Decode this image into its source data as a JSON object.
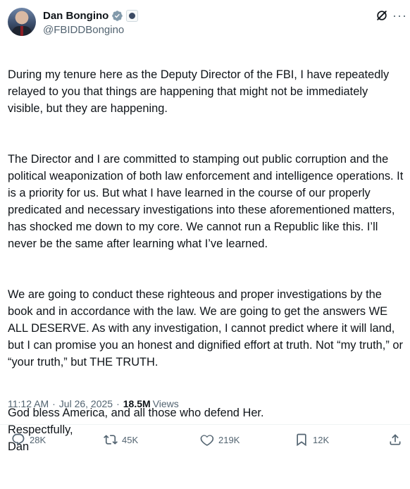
{
  "author": {
    "name": "Dan Bongino",
    "handle": "@FBIDDBongino"
  },
  "post": {
    "paragraphs": [
      "During my tenure here as the Deputy Director of the FBI, I have repeatedly relayed to you that things are happening that might not be immediately visible, but they are happening.",
      "The Director and I are committed to stamping out public corruption and the political weaponization of both law enforcement and intelligence operations. It is a priority for us. But what I have learned in the course of our properly predicated and necessary investigations into these aforementioned matters, has shocked me down to my core. We cannot run a Republic like this. I’ll never be the same after learning what I’ve learned.",
      "We are going to conduct these righteous and proper investigations by the book and in accordance with the law. We are going to get the answers WE ALL DESERVE. As with any investigation, I cannot predict where it will land, but I can promise you an honest and dignified effort at truth. Not “my truth,” or “your truth,” but THE TRUTH.",
      "God bless America, and all those who defend Her.\nRespectfully,\nDan"
    ]
  },
  "meta": {
    "time": "11:12 AM",
    "separator": "·",
    "date": "Jul 26, 2025",
    "views_count": "18.5M",
    "views_label": "Views"
  },
  "actions": {
    "replies": "28K",
    "reposts": "45K",
    "likes": "219K",
    "bookmarks": "12K"
  },
  "icons": {
    "verified": "verified-badge-icon",
    "grok": "grok-icon",
    "more": "more-icon",
    "reply": "reply-icon",
    "repost": "repost-icon",
    "like": "heart-icon",
    "bookmark": "bookmark-icon",
    "share": "share-icon"
  },
  "colors": {
    "text": "#0f1419",
    "secondary": "#536471",
    "verified": "#829aab"
  }
}
